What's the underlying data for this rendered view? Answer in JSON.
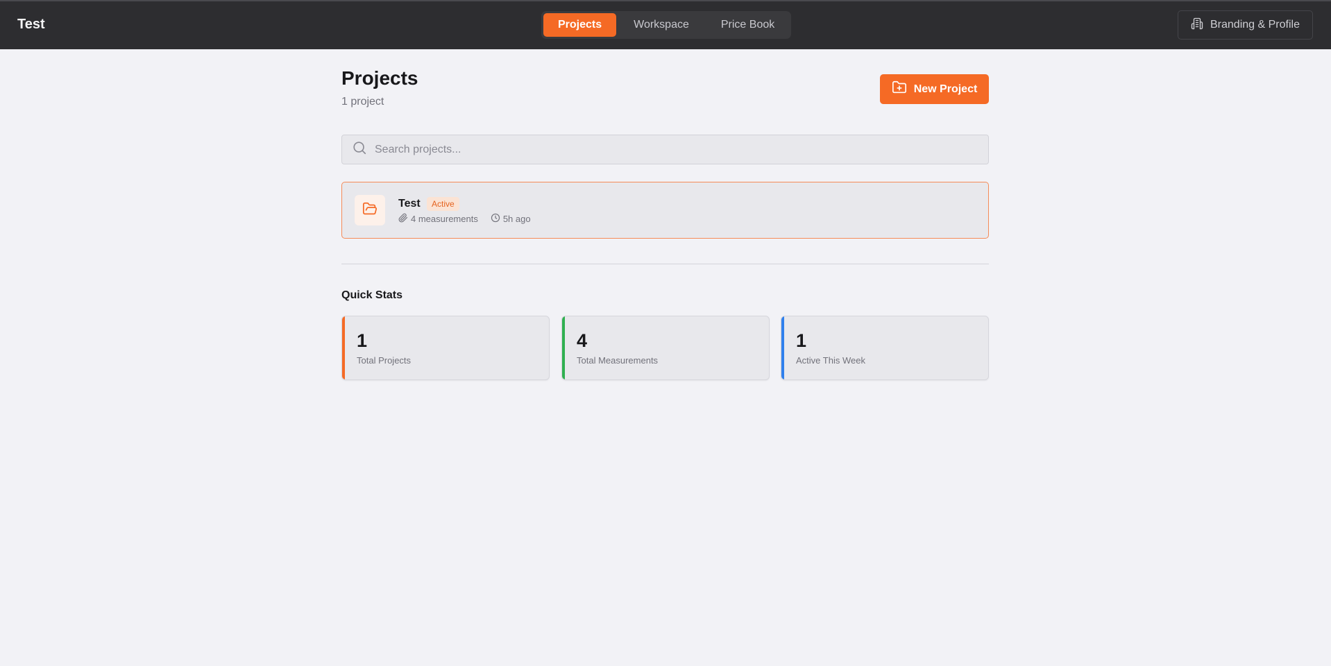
{
  "app": {
    "title": "Test"
  },
  "nav": {
    "tabs": [
      {
        "label": "Projects",
        "active": true
      },
      {
        "label": "Workspace",
        "active": false
      },
      {
        "label": "Price Book",
        "active": false
      }
    ]
  },
  "header_actions": {
    "branding_label": "Branding & Profile"
  },
  "page": {
    "title": "Projects",
    "subtitle": "1 project",
    "new_button_label": "New Project"
  },
  "search": {
    "placeholder": "Search projects...",
    "value": ""
  },
  "projects": [
    {
      "name": "Test",
      "status": "Active",
      "measurements": "4 measurements",
      "updated": "5h ago"
    }
  ],
  "quick_stats": {
    "title": "Quick Stats",
    "items": [
      {
        "value": "1",
        "label": "Total Projects",
        "color": "#f56a25"
      },
      {
        "value": "4",
        "label": "Total Measurements",
        "color": "#2fb050"
      },
      {
        "value": "1",
        "label": "Active This Week",
        "color": "#2f80ed"
      }
    ]
  },
  "colors": {
    "accent": "#f56a25",
    "topbar": "#2d2d30",
    "background": "#f2f2f6"
  },
  "icons": {
    "branding": "building-icon",
    "new_project": "folder-plus-icon",
    "search": "search-icon",
    "project": "folder-open-icon",
    "measurements": "paperclip-icon",
    "updated": "clock-icon"
  }
}
